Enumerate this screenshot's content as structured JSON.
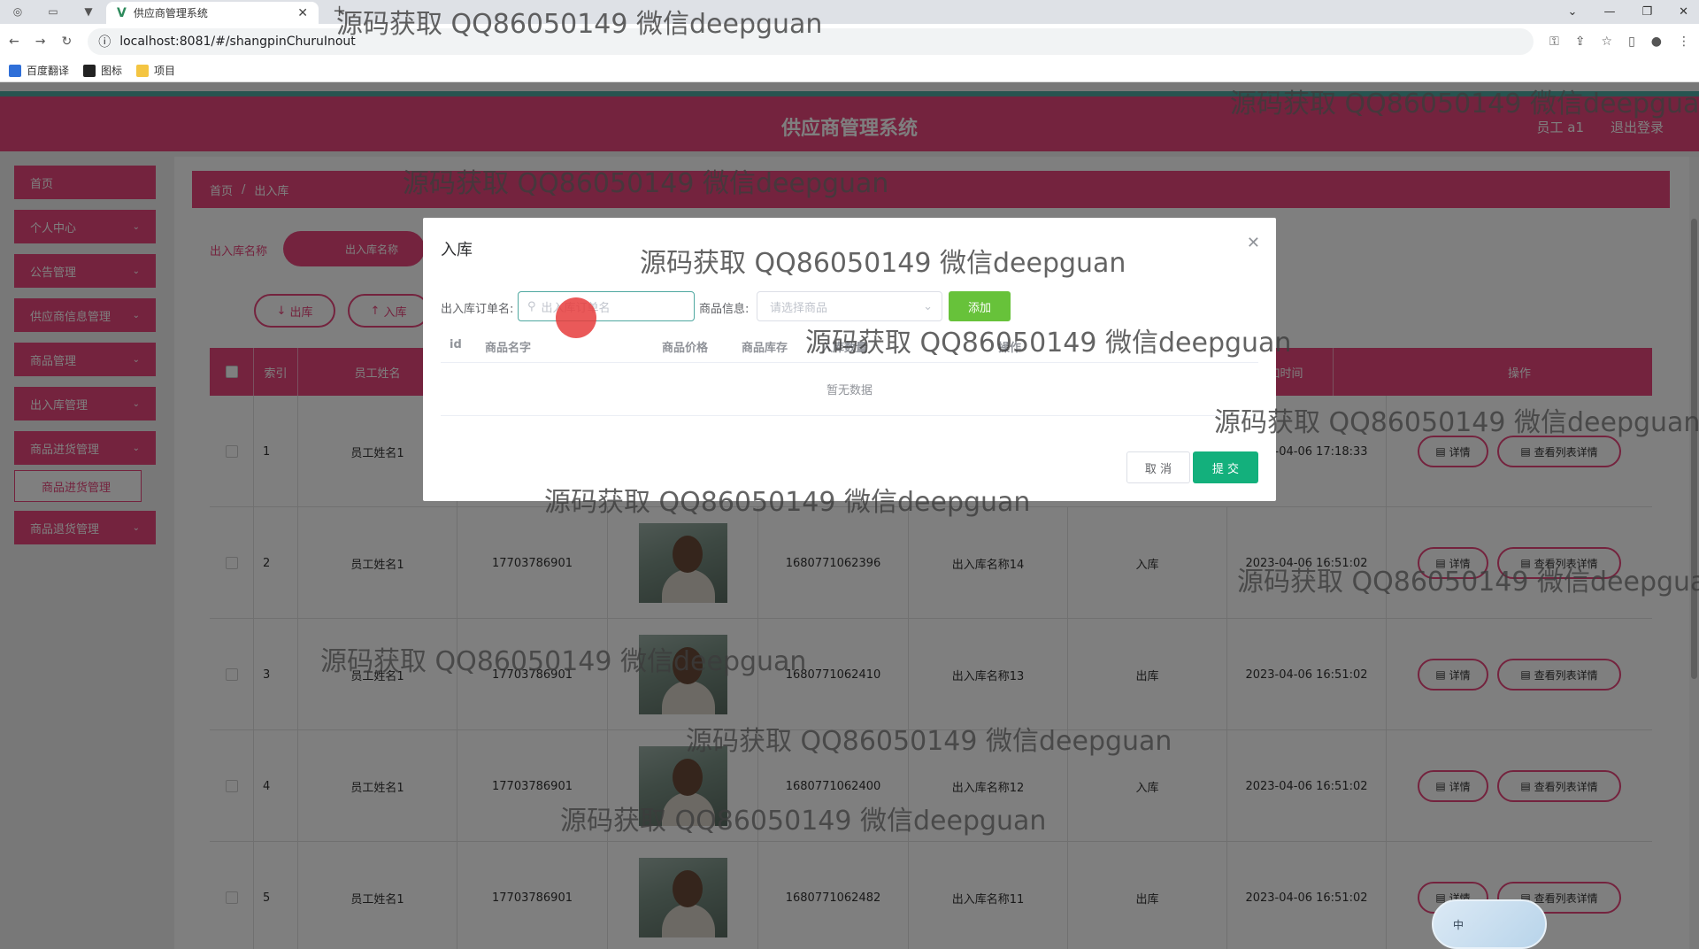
{
  "browser": {
    "tab_title": "供应商管理系统",
    "url": "localhost:8081/#/shangpinChuruInout",
    "bookmarks": [
      "百度翻译",
      "图标",
      "项目"
    ]
  },
  "header": {
    "system_title": "供应商管理系统",
    "user_label": "员工 a1",
    "logout_label": "退出登录"
  },
  "sidebar": {
    "items": [
      {
        "label": "首页",
        "chevron": false
      },
      {
        "label": "个人中心",
        "chevron": true
      },
      {
        "label": "公告管理",
        "chevron": true
      },
      {
        "label": "供应商信息管理",
        "chevron": true
      },
      {
        "label": "商品管理",
        "chevron": true
      },
      {
        "label": "出入库管理",
        "chevron": true
      },
      {
        "label": "商品进货管理",
        "chevron": true
      },
      {
        "label": "商品退货管理",
        "chevron": true
      }
    ],
    "active_sub": "商品进货管理"
  },
  "breadcrumb": {
    "home": "首页",
    "separator": "/",
    "current": "出入库"
  },
  "search": {
    "label": "出入库名称",
    "placeholder": "出入库名称"
  },
  "toolbar": {
    "out_label": "出库",
    "in_label": "入库"
  },
  "table": {
    "headers": {
      "index": "索引",
      "employee": "员工姓名",
      "action": "操作",
      "time": "添加时间"
    },
    "rows": [
      {
        "index": "1",
        "employee": "员工姓名1",
        "phone": "",
        "code": "",
        "name": "",
        "type": "",
        "time": "2023-04-06 17:18:33"
      },
      {
        "index": "2",
        "employee": "员工姓名1",
        "phone": "17703786901",
        "code": "1680771062396",
        "name": "出入库名称14",
        "type": "入库",
        "time": "2023-04-06 16:51:02"
      },
      {
        "index": "3",
        "employee": "员工姓名1",
        "phone": "17703786901",
        "code": "1680771062410",
        "name": "出入库名称13",
        "type": "出库",
        "time": "2023-04-06 16:51:02"
      },
      {
        "index": "4",
        "employee": "员工姓名1",
        "phone": "17703786901",
        "code": "1680771062400",
        "name": "出入库名称12",
        "type": "入库",
        "time": "2023-04-06 16:51:02"
      },
      {
        "index": "5",
        "employee": "员工姓名1",
        "phone": "17703786901",
        "code": "1680771062482",
        "name": "出入库名称11",
        "type": "出库",
        "time": "2023-04-06 16:51:02"
      }
    ],
    "detail_label": "详情",
    "list_detail_label": "查看列表详情"
  },
  "modal": {
    "title": "入库",
    "order_label": "出入库订单名:",
    "order_placeholder": "出入库订单名",
    "goods_label": "商品信息:",
    "goods_placeholder": "请选择商品",
    "add_label": "添加",
    "columns": {
      "id": "id",
      "name": "商品名字",
      "price": "商品价格",
      "stock": "商品库存",
      "quantity": "入库数量",
      "operation": "操作"
    },
    "empty_text": "暂无数据",
    "cancel_label": "取 消",
    "submit_label": "提 交"
  },
  "ime": {
    "label": "中"
  },
  "watermark": "源码获取 QQ86050149 微信deepguan",
  "colors": {
    "primary": "#e8467c",
    "teal": "#4fa8a0",
    "add_green": "#67c23a",
    "submit_green": "#13b07c"
  }
}
